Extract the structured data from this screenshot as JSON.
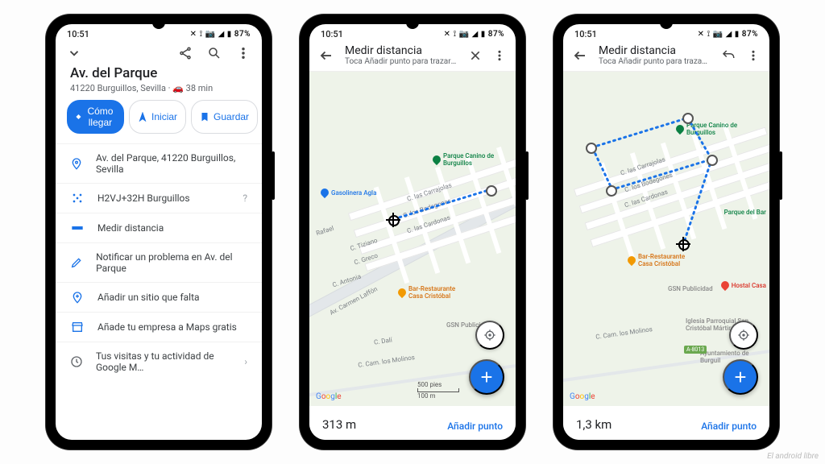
{
  "status": {
    "time": "10:51",
    "indicators": "✕ ⟟ 📷 ◢ ▮ 87%"
  },
  "s1": {
    "title": "Av. del Parque",
    "subtitle": "41220 Burguillos, Sevilla · 🚗 38 min",
    "chips": {
      "directions": "Cómo llegar",
      "start": "Iniciar",
      "save": "Guardar"
    },
    "rows": {
      "address": "Av. del Parque, 41220 Burguillos, Sevilla",
      "pluscode": "H2VJ+32H Burguillos",
      "measure": "Medir distancia",
      "report": "Notificar un problema en Av. del Parque",
      "missing": "Añadir un sitio que falta",
      "business": "Añade tu empresa a Maps gratis",
      "history": "Tus visitas y tu actividad de Google M…"
    }
  },
  "measure_header": {
    "title": "Medir distancia",
    "subtitle": "Toca Añadir punto para trazar l…"
  },
  "map": {
    "pois": {
      "park": "Parque Canino de Burguillos",
      "gas": "Gasolinera Agla",
      "rest": "Bar-Restaurante Casa Cristóbal",
      "gsn": "GSN Publicidad",
      "hostal": "Hostal Casa",
      "church": "Iglesia Parroquial San Cristóbal Mártir de",
      "ayto": "Ayuntamiento de Burguil",
      "parquebar": "Parque del Bar"
    },
    "streets": {
      "carrajolas": "C. las Carrajolas",
      "bodegones": "C. los Bodegones",
      "cardonas": "C. las Cardonas",
      "tiziano": "C. Tiziano",
      "greco": "C. Greco",
      "rafael": "Rafael",
      "antonia": "C. Antonia",
      "laffon": "Av. Carmen Laffón",
      "dali": "C. Dalí",
      "molinos": "C. Cam. los Molinos"
    },
    "highway": "A-8013",
    "attribution": "Google",
    "scale_top": "500 pies",
    "scale_bot": "100 m"
  },
  "s2": {
    "distance": "313 m",
    "action": "Añadir punto"
  },
  "s3": {
    "distance": "1,3 km",
    "action": "Añadir punto"
  },
  "watermark": "El android libre"
}
